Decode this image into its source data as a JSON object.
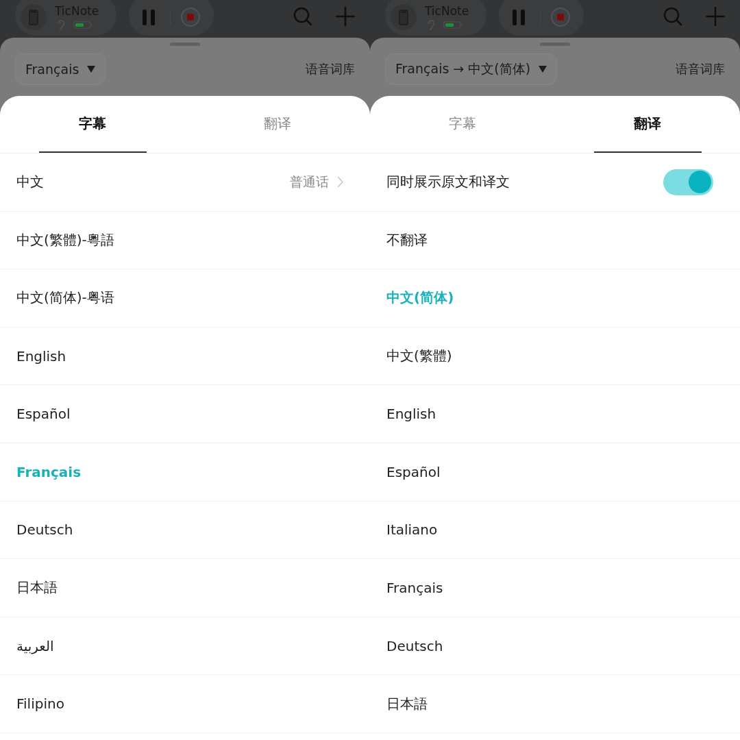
{
  "panels": [
    {
      "top_bar": {
        "device_name": "TicNote"
      },
      "sheet_header": {
        "language_dropdown": "Français",
        "vocabulary_link": "语音词库"
      },
      "tabs": [
        {
          "label": "字幕",
          "selected": true
        },
        {
          "label": "翻译",
          "selected": false
        }
      ],
      "rows": [
        {
          "kind": "detail",
          "label": "中文",
          "detail": "普通话",
          "selected": false
        },
        {
          "kind": "option",
          "label": "中文(繁體)-粵語",
          "selected": false
        },
        {
          "kind": "option",
          "label": "中文(简体)-粤语",
          "selected": false
        },
        {
          "kind": "option",
          "label": "English",
          "selected": false
        },
        {
          "kind": "option",
          "label": "Español",
          "selected": false
        },
        {
          "kind": "option",
          "label": "Français",
          "selected": true
        },
        {
          "kind": "option",
          "label": "Deutsch",
          "selected": false
        },
        {
          "kind": "option",
          "label": "日本語",
          "selected": false
        },
        {
          "kind": "option",
          "label": "العربية",
          "selected": false
        },
        {
          "kind": "option",
          "label": "Filipino",
          "selected": false
        }
      ]
    },
    {
      "top_bar": {
        "device_name": "TicNote"
      },
      "sheet_header": {
        "language_dropdown": "Français → 中文(简体)",
        "vocabulary_link": "语音词库"
      },
      "tabs": [
        {
          "label": "字幕",
          "selected": false
        },
        {
          "label": "翻译",
          "selected": true
        }
      ],
      "rows": [
        {
          "kind": "toggle",
          "label": "同时展示原文和译文",
          "on": true,
          "selected": false
        },
        {
          "kind": "option",
          "label": "不翻译",
          "selected": false
        },
        {
          "kind": "option",
          "label": "中文(简体)",
          "selected": true
        },
        {
          "kind": "option",
          "label": "中文(繁體)",
          "selected": false
        },
        {
          "kind": "option",
          "label": "English",
          "selected": false
        },
        {
          "kind": "option",
          "label": "Español",
          "selected": false
        },
        {
          "kind": "option",
          "label": "Italiano",
          "selected": false
        },
        {
          "kind": "option",
          "label": "Français",
          "selected": false
        },
        {
          "kind": "option",
          "label": "Deutsch",
          "selected": false
        },
        {
          "kind": "option",
          "label": "日本語",
          "selected": false
        }
      ]
    }
  ]
}
